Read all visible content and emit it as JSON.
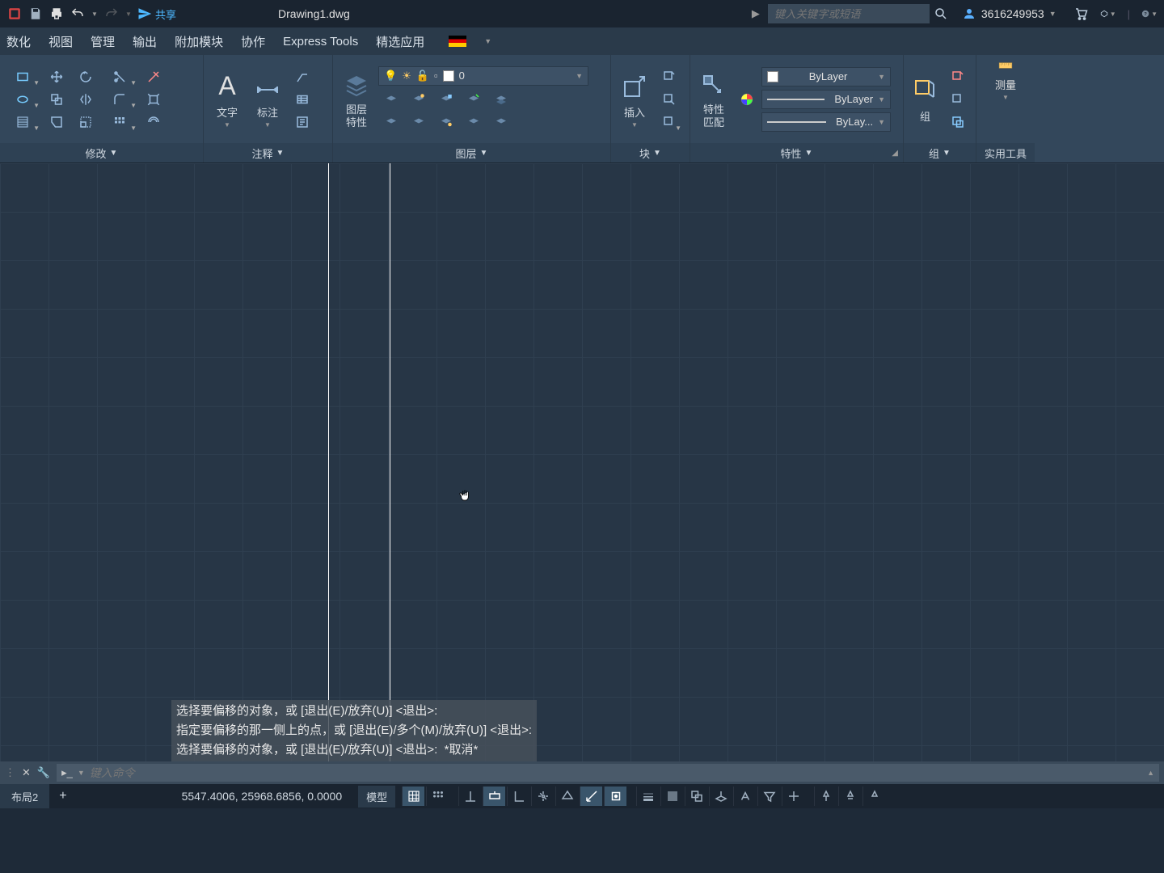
{
  "titlebar": {
    "share_label": "共享",
    "doc_title": "Drawing1.dwg",
    "search_placeholder": "键入关键字或短语",
    "username": "3616249953"
  },
  "menu": {
    "items": [
      "数化",
      "视图",
      "管理",
      "输出",
      "附加模块",
      "协作",
      "Express Tools",
      "精选应用"
    ]
  },
  "ribbon": {
    "modify_label": "修改",
    "annotate_label": "注释",
    "text_label": "文字",
    "dim_label": "标注",
    "layers_label": "图层",
    "layer_props_label": "图层\n特性",
    "layer_current": "0",
    "block_label": "块",
    "insert_label": "插入",
    "props_label": "特性",
    "props_match_label": "特性\n匹配",
    "bylayer1": "ByLayer",
    "bylayer2": "ByLayer",
    "bylayer3": "ByLay...",
    "group_label": "组",
    "group_big": "组",
    "util_label": "实用工具",
    "measure_label": "测量"
  },
  "command": {
    "line1": "选择要偏移的对象，或 [退出(E)/放弃(U)] <退出>:",
    "line2": "指定要偏移的那一侧上的点，或 [退出(E)/多个(M)/放弃(U)] <退出>:",
    "line3": "选择要偏移的对象，或 [退出(E)/放弃(U)] <退出>:  *取消*",
    "input_placeholder": "键入命令"
  },
  "status": {
    "layout_tab": "布局2",
    "coords": "5547.4006, 25968.6856, 0.0000",
    "model": "模型"
  }
}
